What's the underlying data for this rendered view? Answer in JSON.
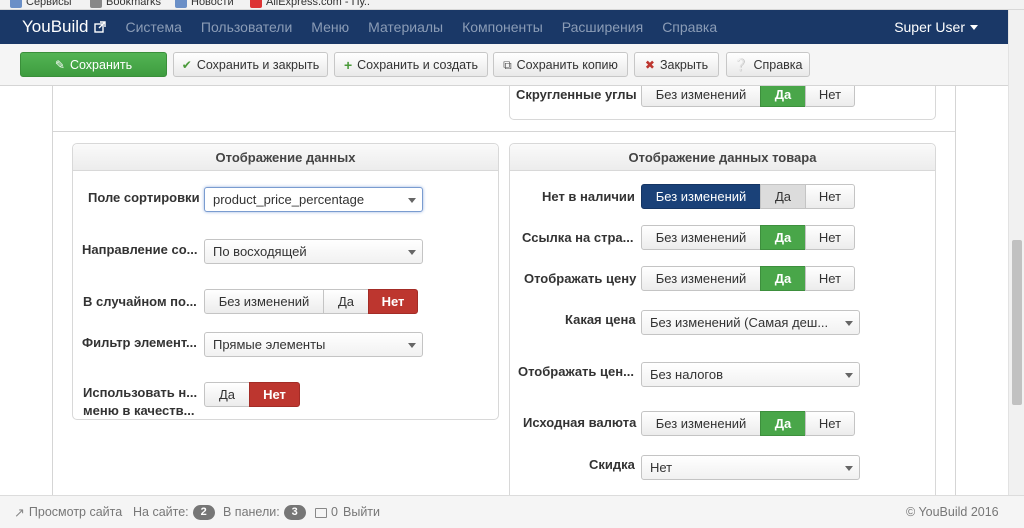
{
  "bookmarks": [
    "Сервисы",
    "Bookmarks",
    "Новости",
    "AliExpress.com - Пу.."
  ],
  "navbar": {
    "brand": "YouBuild",
    "menu": [
      "Система",
      "Пользователи",
      "Меню",
      "Материалы",
      "Компоненты",
      "Расширения",
      "Справка"
    ],
    "user": "Super User"
  },
  "toolbar": {
    "save": "Сохранить",
    "save_close": "Сохранить и закрыть",
    "save_new": "Сохранить и создать",
    "save_copy": "Сохранить копию",
    "close": "Закрыть",
    "help": "Справка"
  },
  "top_right": {
    "label": "Скругленные углы",
    "options": [
      "Без изменений",
      "Да",
      "Нет"
    ],
    "selected": "Да"
  },
  "left_panel": {
    "title": "Отображение данных",
    "sort_field": {
      "label": "Поле сортировки",
      "value": "product_price_percentage"
    },
    "direction": {
      "label": "Направление со...",
      "value": "По восходящей"
    },
    "random": {
      "label": "В случайном по...",
      "options": [
        "Без изменений",
        "Да",
        "Нет"
      ],
      "selected": "Нет"
    },
    "filter": {
      "label": "Фильтр элемент...",
      "value": "Прямые элементы"
    },
    "use_menu": {
      "label_line1": "Использовать н...",
      "label_line2": "меню в качеств...",
      "options": [
        "Да",
        "Нет"
      ],
      "selected": "Нет"
    }
  },
  "right_panel": {
    "title": "Отображение данных товара",
    "out_of_stock": {
      "label": "Нет в наличии",
      "options": [
        "Без изменений",
        "Да",
        "Нет"
      ],
      "selected": "Без изменений"
    },
    "link": {
      "label": "Ссылка на стра...",
      "options": [
        "Без изменений",
        "Да",
        "Нет"
      ],
      "selected": "Да"
    },
    "show_price": {
      "label": "Отображать цену",
      "options": [
        "Без изменений",
        "Да",
        "Нет"
      ],
      "selected": "Да"
    },
    "which_price": {
      "label": "Какая цена",
      "value": "Без изменений (Самая деш..."
    },
    "show_price_tax": {
      "label": "Отображать цен...",
      "value": "Без налогов"
    },
    "base_currency": {
      "label": "Исходная валюта",
      "options": [
        "Без изменений",
        "Да",
        "Нет"
      ],
      "selected": "Да"
    },
    "discount": {
      "label": "Скидка",
      "value": "Нет"
    }
  },
  "statusbar": {
    "preview": "Просмотр сайта",
    "on_site_label": "На сайте:",
    "on_site_count": "2",
    "in_panel_label": "В панели:",
    "in_panel_count": "3",
    "messages_count": "0",
    "logout": "Выйти",
    "copyright": "© YouBuild 2016"
  },
  "colors": {
    "navbar": "#1a3867",
    "save_green": "#49a649",
    "no_red": "#bd362f",
    "selected_blue": "#1a4178"
  }
}
